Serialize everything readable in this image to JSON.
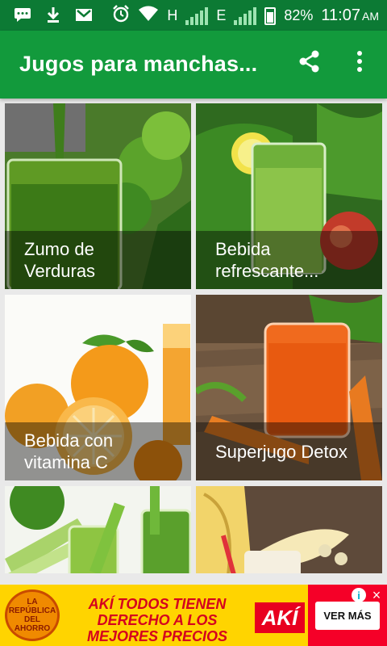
{
  "status_bar": {
    "battery": "82%",
    "time": "11:07",
    "ampm": "AM",
    "network_h": "H",
    "network_e": "E",
    "icons": [
      "message-icon",
      "download-icon",
      "gmail-icon",
      "alarm-icon",
      "wifi-icon",
      "signal-icon",
      "battery-icon"
    ]
  },
  "appbar": {
    "title": "Jugos para manchas...",
    "icons": [
      "share-icon",
      "more-vert-icon"
    ],
    "color": "#129a3c"
  },
  "cards": [
    {
      "label": "Zumo de\nVerduras"
    },
    {
      "label": "Bebida\nrefrescante..."
    },
    {
      "label": "Bebida con\nvitamina C"
    },
    {
      "label": "Superjugo Detox"
    },
    {
      "label": ""
    },
    {
      "label": ""
    }
  ],
  "ad": {
    "logo_text": "LA REPÚBLICA DEL AHORRO",
    "headline": "AKÍ TODOS TIENEN DERECHO A LOS MEJORES PRECIOS",
    "brand": "AKÍ",
    "cta": "VER MÁS",
    "info": "i",
    "close": "×"
  }
}
